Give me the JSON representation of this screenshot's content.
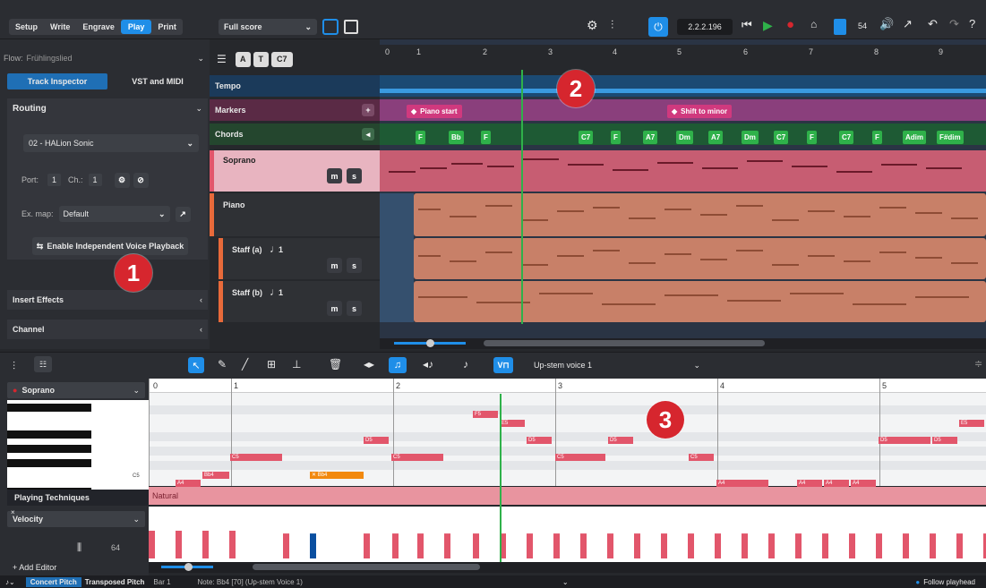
{
  "modes": [
    "Setup",
    "Write",
    "Engrave",
    "Play",
    "Print"
  ],
  "active_mode": "Play",
  "layout_select": "Full score",
  "timecode": "2.2.2.196",
  "tempo_value": "54",
  "flow": {
    "label": "Flow:",
    "value": "Frühlingslied"
  },
  "inspector_tabs": [
    "Track Inspector",
    "VST and MIDI"
  ],
  "routing": {
    "title": "Routing",
    "instrument": "02 - HALion Sonic",
    "port_label": "Port:",
    "port": "1",
    "ch_label": "Ch.:",
    "ch": "1",
    "exmap_label": "Ex. map:",
    "exmap": "Default",
    "ivp_button": "Enable Independent Voice Playback"
  },
  "sections": {
    "insert_effects": "Insert Effects",
    "channel": "Channel"
  },
  "ruler_numbers": [
    "0",
    "1",
    "2",
    "3",
    "4",
    "5",
    "6",
    "7",
    "8",
    "9"
  ],
  "tracks": {
    "tempo": "Tempo",
    "markers": "Markers",
    "chords": "Chords",
    "soprano": "Soprano",
    "piano": "Piano",
    "staff_a": "Staff (a)",
    "staff_b": "Staff (b)",
    "voice_num": "1",
    "m": "m",
    "s": "s"
  },
  "markers": [
    "Piano start",
    "Shift to minor"
  ],
  "chords": [
    "F",
    "Bb",
    "F",
    "C7",
    "F",
    "A7",
    "Dm",
    "A7",
    "Dm",
    "C7",
    "F",
    "C7",
    "F",
    "Adim",
    "F#dim"
  ],
  "lower_toolbar": {
    "voice_select": "Up-stem voice 1"
  },
  "kb_editor": {
    "instrument": "Soprano",
    "c5_label": "C5",
    "ruler": [
      "0",
      "1",
      "2",
      "3",
      "4",
      "5"
    ],
    "playing_techniques": "Playing Techniques",
    "technique": "Natural",
    "velocity_label": "Velocity",
    "velocity_value": "64",
    "add_editor": "+ Add Editor"
  },
  "notes": [
    "A4",
    "Bb4",
    "C5",
    "Bb4",
    "D5",
    "C5",
    "F5",
    "E5",
    "D5",
    "C5",
    "D5",
    "C5",
    "A4",
    "A4",
    "A4",
    "A4",
    "D5",
    "D5",
    "E5"
  ],
  "velocity_bars": [
    0.5,
    0.5,
    0.5,
    0.5,
    0.45,
    0.45,
    0.45,
    0.45,
    0.45,
    0.45,
    0.45,
    0.45,
    0.45,
    0.45,
    0.45,
    0.45,
    0.45,
    0.45,
    0.45,
    0.45,
    0.45,
    0.45,
    0.45,
    0.45,
    0.45,
    0.45,
    0.45,
    0.45,
    0.45,
    0.45,
    0.45,
    0.45
  ],
  "status": {
    "concert": "Concert Pitch",
    "transposed": "Transposed Pitch",
    "bar": "Bar 1",
    "note": "Note: Bb4 [70] (Up-stem Voice 1)",
    "follow": "Follow playhead"
  },
  "callouts": [
    "1",
    "2",
    "3"
  ],
  "colors": {
    "accent": "#1f8ee8",
    "play_green": "#2fb14a",
    "marker_pink": "#d0397e",
    "note_red": "#e2566b",
    "selected_orange": "#f2890f"
  }
}
